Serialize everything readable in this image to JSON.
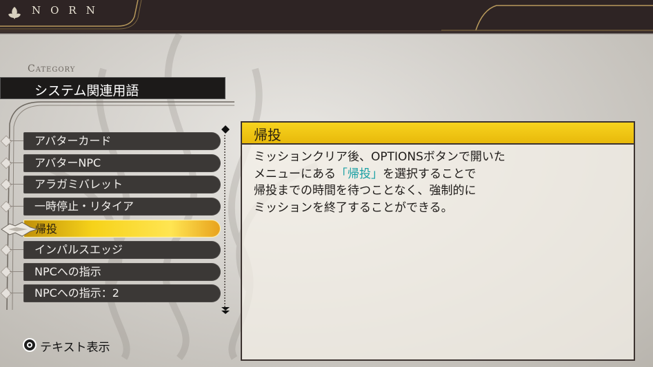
{
  "topbar": {
    "logo_icon": "norn-leaf-icon",
    "brand": "NORN"
  },
  "category": {
    "label": "Category",
    "value": "システム関連用語"
  },
  "list": {
    "items": [
      {
        "label": "アバターカード",
        "selected": false
      },
      {
        "label": "アバターNPC",
        "selected": false
      },
      {
        "label": "アラガミバレット",
        "selected": false
      },
      {
        "label": "一時停止・リタイア",
        "selected": false
      },
      {
        "label": "帰投",
        "selected": true
      },
      {
        "label": "インパルスエッジ",
        "selected": false
      },
      {
        "label": "NPCへの指示",
        "selected": false
      },
      {
        "label": "NPCへの指示：2",
        "selected": false
      }
    ],
    "scroll_up_icon": "diamond-icon",
    "scroll_down_icon": "double-chevron-down-icon"
  },
  "detail": {
    "title": "帰投",
    "line1": "ミッションクリア後、OPTIONSボタンで開いた",
    "line2_pre": "メニューにある",
    "line2_hl": "「帰投」",
    "line2_post": "を選択することで",
    "line3": "帰投までの時間を待つことなく、強制的に",
    "line4": "ミッションを終了することができる。"
  },
  "prompt": {
    "button_icon": "circle-button-icon",
    "label": "テキスト表示"
  },
  "colors": {
    "highlight": "#1aa0a4",
    "selected_yellow": "#f6d21a",
    "topbar": "#2e2424"
  }
}
